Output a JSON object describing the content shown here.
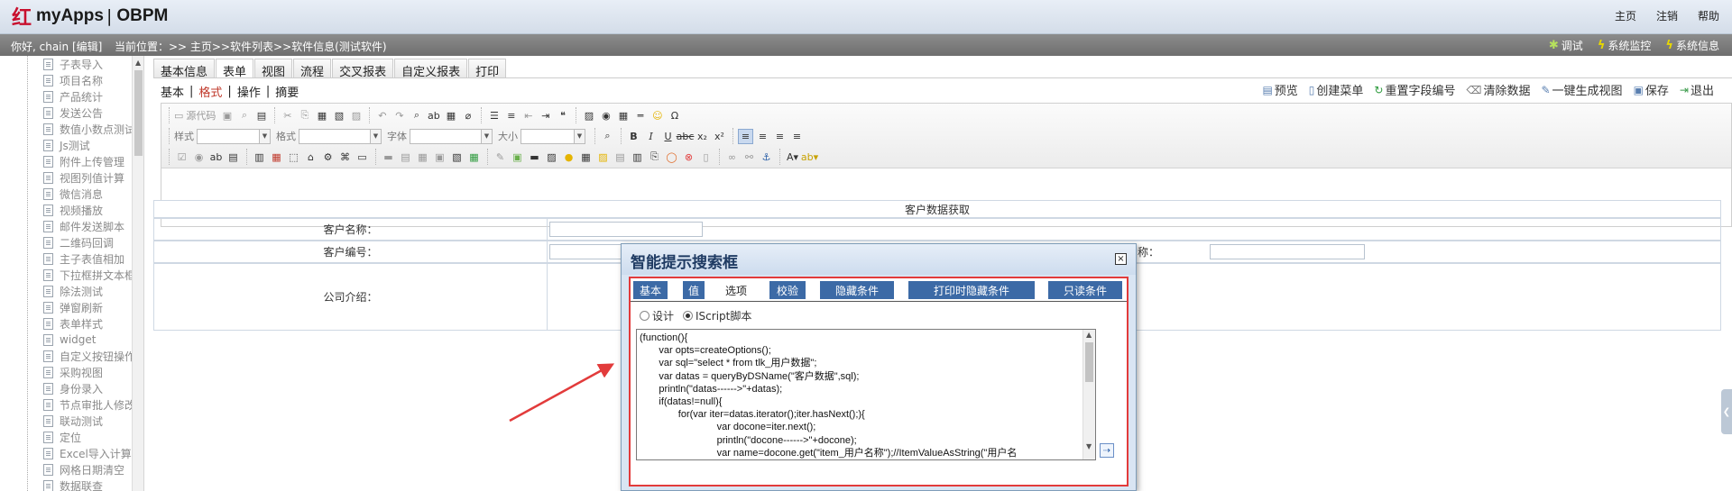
{
  "app": {
    "brand": "myApps",
    "separator": "|",
    "product": "OBPM",
    "logo_glyph": "红"
  },
  "toplinks": [
    "主页",
    "注销",
    "帮助"
  ],
  "status": {
    "greeting": "你好, chain [编辑]",
    "breadcrumb": "当前位置：>> 主页>>软件列表>>软件信息(测试软件)",
    "right": [
      {
        "label": "调试",
        "icon": "bug-icon"
      },
      {
        "label": "系统监控",
        "icon": "bolt-icon"
      },
      {
        "label": "系统信息",
        "icon": "bolt-icon"
      }
    ]
  },
  "sidebar": {
    "items": [
      "子表导入",
      "项目名称",
      "产品统计",
      "发送公告",
      "数值小数点测试",
      "Js测试",
      "附件上传管理",
      "视图列值计算",
      "微信消息",
      "视频播放",
      "邮件发送脚本",
      "二维码回调",
      "主子表值相加",
      "下拉框拼文本框",
      "除法测试",
      "弹窗刷新",
      "表单样式",
      "widget",
      "自定义按钮操作",
      "采购视图",
      "身份录入",
      "节点审批人修改",
      "联动测试",
      "定位",
      "Excel导入计算",
      "网格日期清空",
      "数据联查"
    ]
  },
  "tabs": [
    "基本信息",
    "表单",
    "视图",
    "流程",
    "交叉报表",
    "自定义报表",
    "打印"
  ],
  "subtabs": [
    "基本",
    "格式",
    "操作",
    "摘要"
  ],
  "actions": [
    {
      "label": "预览",
      "icon": "preview-icon"
    },
    {
      "label": "创建菜单",
      "icon": "menu-icon"
    },
    {
      "label": "重置字段编号",
      "icon": "refresh-icon"
    },
    {
      "label": "清除数据",
      "icon": "trash-icon"
    },
    {
      "label": "一键生成视图",
      "icon": "wand-icon"
    },
    {
      "label": "保存",
      "icon": "save-icon"
    },
    {
      "label": "退出",
      "icon": "exit-icon"
    }
  ],
  "editor": {
    "source_label": "源代码",
    "combos": [
      "样式",
      "格式",
      "字体",
      "大小"
    ]
  },
  "form": {
    "title": "客户数据获取",
    "rows": [
      {
        "label": "客户名称："
      },
      {
        "label": "客户编号：",
        "label2": "称："
      },
      {
        "label": "公司介绍："
      }
    ]
  },
  "dialog": {
    "title": "智能提示搜索框",
    "close": "×",
    "tabs": [
      "基本",
      "值",
      "选项",
      "校验",
      "隐藏条件",
      "打印时隐藏条件",
      "只读条件"
    ],
    "radios": [
      "设计",
      "IScript脚本"
    ],
    "code_lines": [
      "(function(){",
      "       var opts=createOptions();",
      "       var sql=\"select * from tlk_用户数据\";",
      "       var datas = queryByDSName(\"客户数据\",sql);",
      "       println(\"datas------>\"+datas);",
      "       if(datas!=null){",
      "              for(var iter=datas.iterator();iter.hasNext();){",
      "                            var docone=iter.next();",
      "                            println(\"docone------>\"+docone);",
      "                            var name=docone.get(\"item_用户名称\");//ItemValueAsString(\"用户名"
    ]
  },
  "colors": {
    "accent": "#3c6aa6",
    "highlight": "#e23b3b",
    "active_subtab": "#c0392b"
  }
}
